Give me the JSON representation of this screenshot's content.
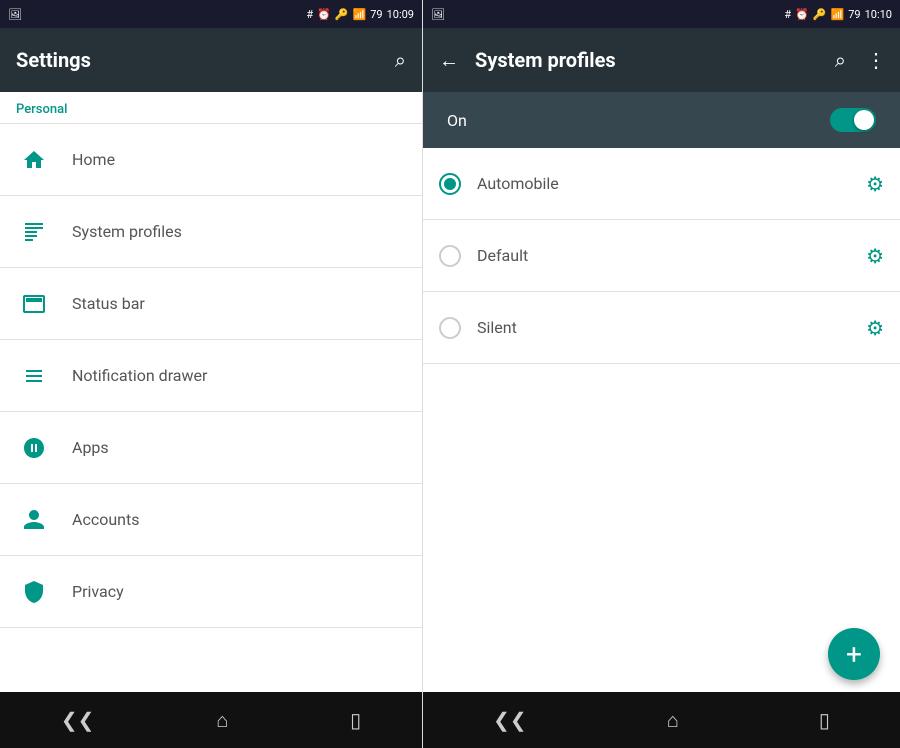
{
  "left": {
    "status_bar": {
      "time": "10:09",
      "left_icon": "image-icon"
    },
    "header": {
      "title": "Settings",
      "search_label": "search"
    },
    "personal_label": "Personal",
    "menu_items": [
      {
        "id": "home",
        "label": "Home",
        "icon": "home"
      },
      {
        "id": "system-profiles",
        "label": "System profiles",
        "icon": "system-profiles"
      },
      {
        "id": "status-bar",
        "label": "Status bar",
        "icon": "status-bar"
      },
      {
        "id": "notification-drawer",
        "label": "Notification drawer",
        "icon": "notification-drawer"
      },
      {
        "id": "apps",
        "label": "Apps",
        "icon": "apps"
      },
      {
        "id": "accounts",
        "label": "Accounts",
        "icon": "accounts"
      },
      {
        "id": "privacy",
        "label": "Privacy",
        "icon": "privacy"
      }
    ],
    "bottom_bar": {
      "back": "◁",
      "home": "△",
      "recents": "▭"
    }
  },
  "right": {
    "status_bar": {
      "time": "10:10",
      "left_icon": "image-icon"
    },
    "header": {
      "back_label": "back",
      "title": "System profiles",
      "search_label": "search",
      "more_label": "more"
    },
    "toggle": {
      "label": "On",
      "state": true
    },
    "profiles": [
      {
        "id": "automobile",
        "label": "Automobile",
        "selected": true
      },
      {
        "id": "default",
        "label": "Default",
        "selected": false
      },
      {
        "id": "silent",
        "label": "Silent",
        "selected": false
      }
    ],
    "fab_label": "+",
    "bottom_bar": {
      "back": "◁",
      "home": "△",
      "recents": "▭"
    }
  }
}
